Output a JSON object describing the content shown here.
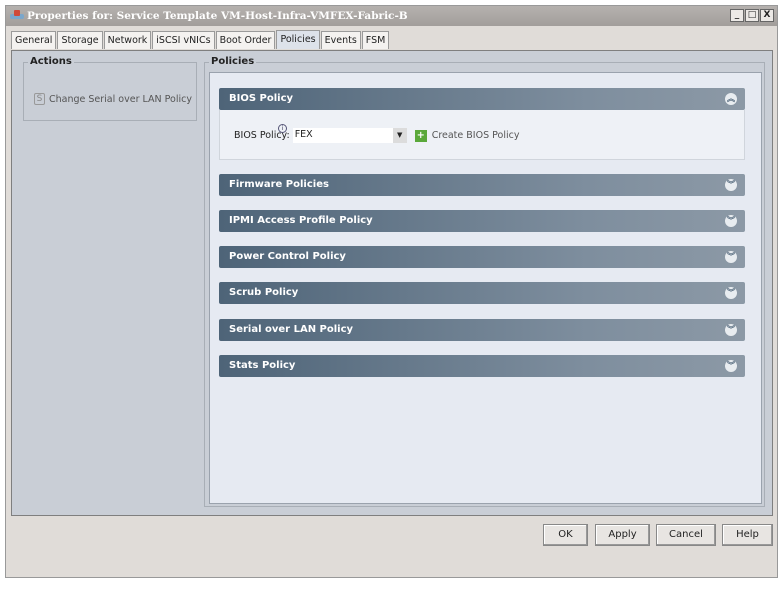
{
  "window": {
    "title": "Properties for: Service Template VM-Host-Infra-VMFEX-Fabric-B",
    "controls": [
      "_",
      "□",
      "X"
    ]
  },
  "tabs": [
    "General",
    "Storage",
    "Network",
    "iSCSI vNICs",
    "Boot Order",
    "Policies",
    "Events",
    "FSM"
  ],
  "active_tab": "Policies",
  "actions": {
    "title": "Actions",
    "items": [
      {
        "label": "Change Serial over LAN Policy"
      }
    ]
  },
  "policies": {
    "title": "Policies",
    "sections": [
      {
        "label": "BIOS Policy",
        "expanded": true
      },
      {
        "label": "Firmware Policies"
      },
      {
        "label": "IPMI Access Profile Policy"
      },
      {
        "label": "Power Control Policy"
      },
      {
        "label": "Scrub Policy"
      },
      {
        "label": "Serial over LAN Policy"
      },
      {
        "label": "Stats Policy"
      }
    ],
    "bios": {
      "field_label": "BIOS Policy:",
      "value": "FEX",
      "create_label": "Create BIOS Policy"
    }
  },
  "buttons": {
    "ok": "OK",
    "apply": "Apply",
    "cancel": "Cancel",
    "help": "Help"
  }
}
